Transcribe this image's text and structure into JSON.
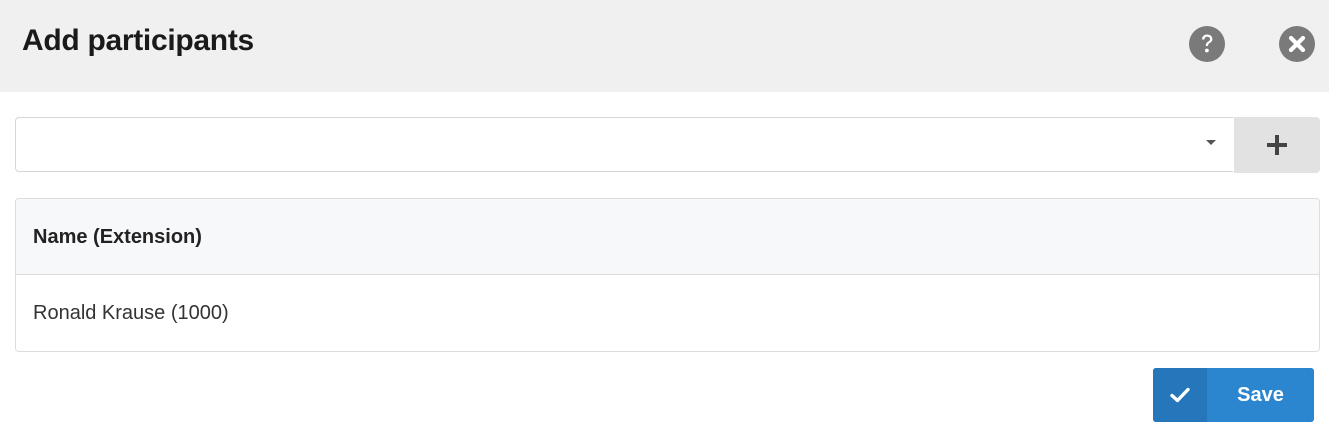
{
  "dialog": {
    "title": "Add participants",
    "help_icon": "question-circle-icon",
    "close_icon": "times-circle-icon"
  },
  "participant_select": {
    "value": "",
    "caret_icon": "caret-down-icon",
    "add_icon": "plus-icon"
  },
  "table": {
    "columns": [
      "Name (Extension)"
    ],
    "rows": [
      [
        "Ronald Krause (1000)"
      ]
    ]
  },
  "footer": {
    "save_label": "Save",
    "save_icon": "check-icon"
  },
  "colors": {
    "header_bg": "#f0f0f0",
    "icon_gray": "#7a7a7a",
    "primary": "#2b86cf",
    "primary_dark": "#2576bb",
    "add_button_bg": "#e2e2e2"
  }
}
